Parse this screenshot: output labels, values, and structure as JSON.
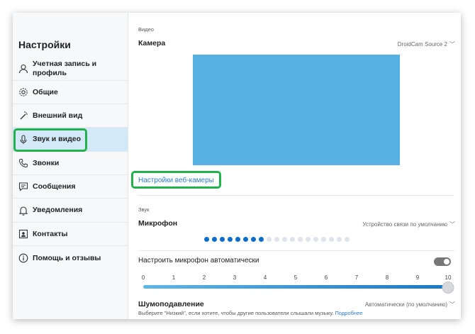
{
  "sidebar": {
    "title": "Настройки",
    "items": [
      {
        "label": "Учетная запись и профиль",
        "icon": "person-icon"
      },
      {
        "label": "Общие",
        "icon": "gear-icon"
      },
      {
        "label": "Внешний вид",
        "icon": "magic-wand-icon"
      },
      {
        "label": "Звук и видео",
        "icon": "microphone-icon",
        "active": true
      },
      {
        "label": "Звонки",
        "icon": "phone-icon"
      },
      {
        "label": "Сообщения",
        "icon": "message-icon"
      },
      {
        "label": "Уведомления",
        "icon": "bell-icon"
      },
      {
        "label": "Контакты",
        "icon": "contact-card-icon"
      },
      {
        "label": "Помощь и отзывы",
        "icon": "info-icon"
      }
    ]
  },
  "video": {
    "section_label": "Видео",
    "camera_label": "Камера",
    "camera_device": "DroidCam Source 2",
    "webcam_settings_link": "Настройки веб-камеры"
  },
  "audio": {
    "section_label": "Звук",
    "microphone_label": "Микрофон",
    "microphone_device": "Устройство связи по умолчанию",
    "level_dots_total": 19,
    "level_dots_active": 8,
    "auto_adjust_label": "Настроить микрофон автоматически",
    "auto_adjust_on": false,
    "scale": [
      "0",
      "1",
      "2",
      "3",
      "4",
      "5",
      "6",
      "7",
      "8",
      "9",
      "10"
    ],
    "volume_value": 10
  },
  "noise": {
    "label": "Шумоподавление",
    "value": "Автоматически (по умолчанию)",
    "description": "Выберите \"Низкий\", если хотите, чтобы другие пользователи слышали музыку.",
    "more_link": "Подробнее"
  },
  "colors": {
    "accent": "#0c6ec8",
    "preview": "#56b1e2",
    "highlight": "#22b14c",
    "active_item": "#d4e9f7"
  }
}
